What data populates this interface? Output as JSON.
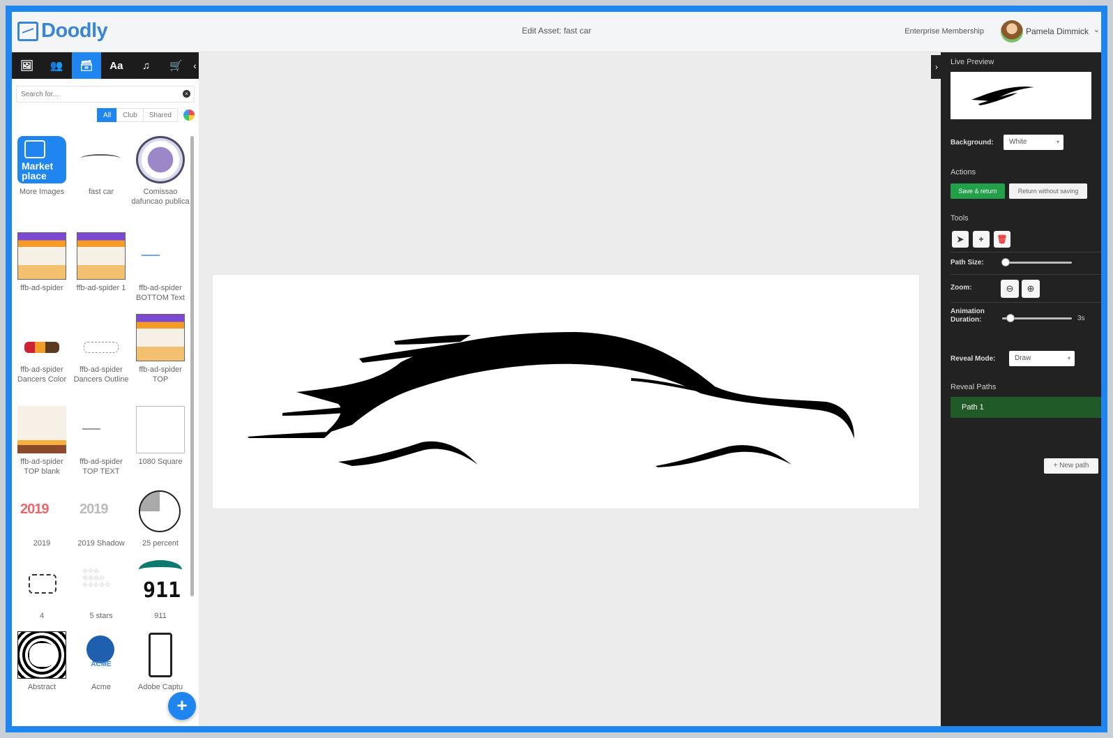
{
  "app": {
    "name": "Doodly",
    "page_title": "Edit Asset: fast car"
  },
  "header": {
    "membership": "Enterprise Membership",
    "user_name": "Pamela Dimmick"
  },
  "left_panel": {
    "tabs": [
      {
        "name": "images",
        "icon": "image-icon",
        "glyph": "🖼"
      },
      {
        "name": "characters",
        "icon": "people-icon",
        "glyph": "👥"
      },
      {
        "name": "props",
        "icon": "archive-icon",
        "glyph": "🗃",
        "active": true
      },
      {
        "name": "text",
        "icon": "font-icon",
        "glyph": "Aa"
      },
      {
        "name": "music",
        "icon": "music-icon",
        "glyph": "♫"
      },
      {
        "name": "store",
        "icon": "cart-icon",
        "glyph": "🛒"
      }
    ],
    "collapse_glyph": "‹",
    "search": {
      "placeholder": "Search for...",
      "value": ""
    },
    "filters": [
      "All",
      "Club",
      "Shared"
    ],
    "assets": [
      "More Images",
      "fast car",
      "Comissao dafuncao publica",
      "ffb-ad-spider",
      "ffb-ad-spider 1",
      "ffb-ad-spider BOTTOM Text",
      "ffb-ad-spider Dancers Color",
      "ffb-ad-spider Dancers Outline",
      "ffb-ad-spider TOP",
      "ffb-ad-spider TOP blank",
      "ffb-ad-spider TOP TEXT",
      "1080 Square",
      "2019",
      "2019 Shadow",
      "25 percent",
      "4",
      "5 stars",
      "911",
      "Abstract",
      "Acme",
      "Adobe Captu"
    ],
    "marketplace_text": "Market place",
    "thumb_texts": {
      "year": "2019",
      "emergency": "911",
      "stars": "☆☆☆\n☆☆☆☆\n☆☆☆☆☆",
      "acme": "ACME"
    },
    "fab_label": "+"
  },
  "right_panel": {
    "toggle_glyph": "›",
    "live_preview_label": "Live Preview",
    "background_label": "Background:",
    "background_value": "White",
    "actions_label": "Actions",
    "save_label": "Save & return",
    "return_label": "Return without saving",
    "tools_label": "Tools",
    "path_size_label": "Path Size:",
    "path_size_level": 0.05,
    "zoom_label": "Zoom:",
    "animation_duration_label": "Animation Duration:",
    "animation_duration_value": "3s",
    "animation_duration_level": 0.12,
    "reveal_mode_label": "Reveal Mode:",
    "reveal_mode_value": "Draw",
    "reveal_paths_label": "Reveal Paths",
    "paths": [
      "Path 1"
    ],
    "new_path_label": "+ New path"
  },
  "colors": {
    "accent": "#1f86f0",
    "green": "#22a04a",
    "path_selected": "#1f5a28",
    "dark_panel": "#222222"
  }
}
